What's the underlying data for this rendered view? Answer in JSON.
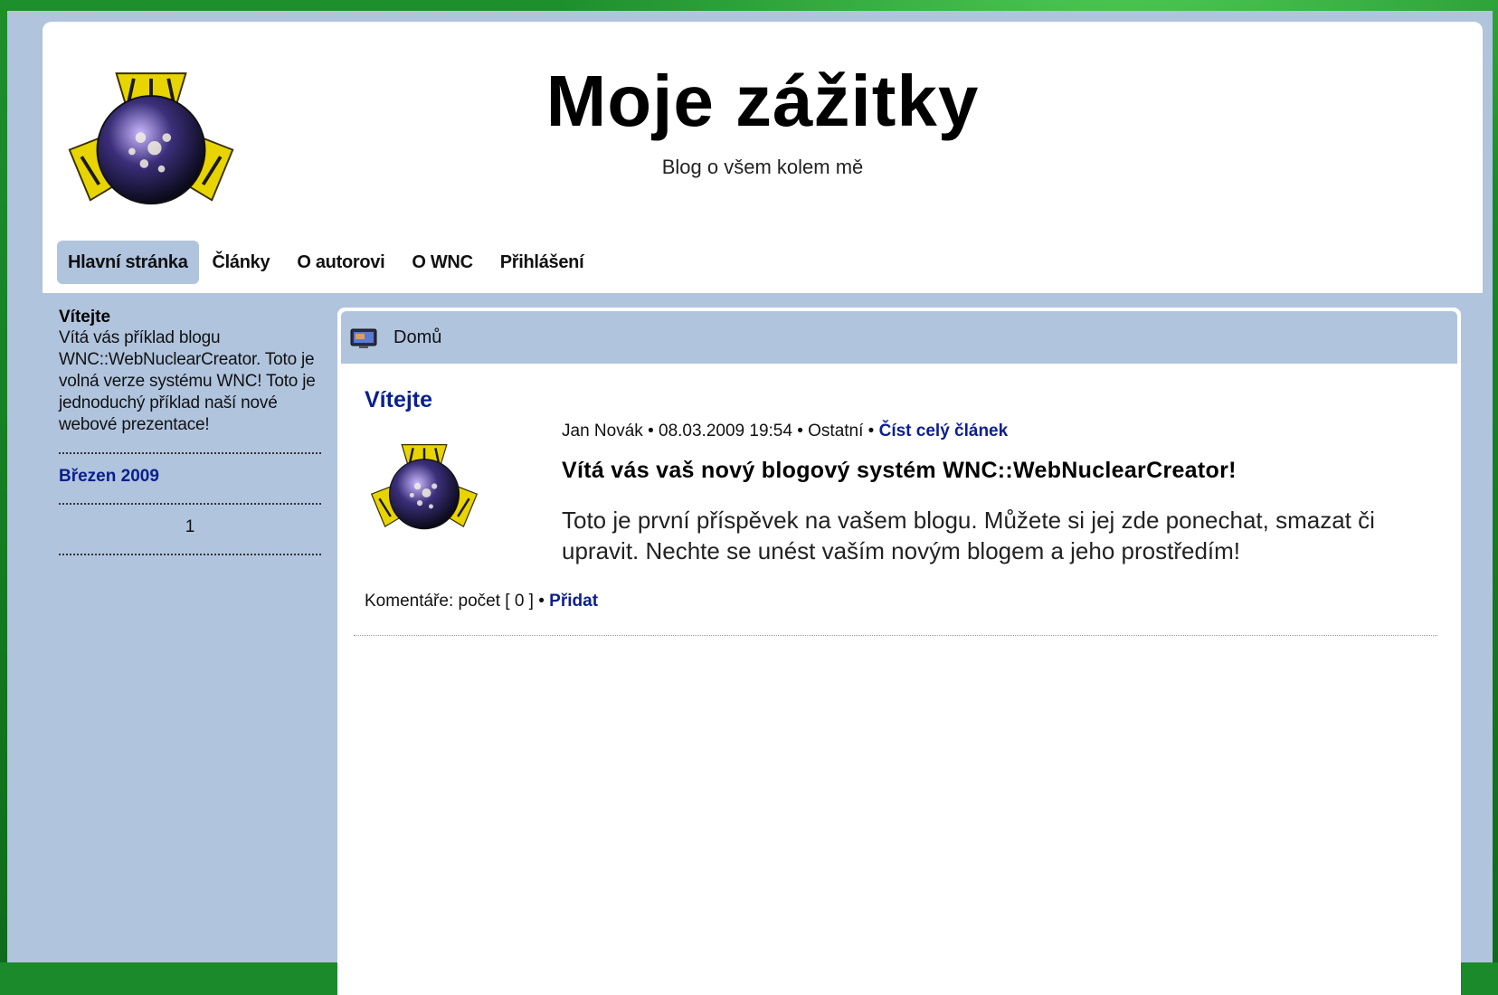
{
  "site": {
    "title": "Moje zážitky",
    "subtitle": "Blog o všem kolem mě",
    "logo_icon": "radiation-globe-icon"
  },
  "nav": {
    "items": [
      {
        "label": "Hlavní stránka",
        "active": true
      },
      {
        "label": "Články"
      },
      {
        "label": "O autorovi"
      },
      {
        "label": "O WNC"
      },
      {
        "label": "Přihlášení"
      }
    ]
  },
  "sidebar": {
    "welcome_title": "Vítejte",
    "welcome_text": "Vítá vás příklad blogu WNC::WebNuclearCreator. Toto je volná verze systému WNC! Toto je jednoduchý příklad naší nové webové prezentace!",
    "archive_month": "Březen 2009",
    "page_number": "1"
  },
  "breadcrumb": {
    "icon": "monitor-icon",
    "label": "Domů"
  },
  "post": {
    "title": "Vítejte",
    "author": "Jan Novák",
    "date": "08.03.2009 19:54",
    "category": "Ostatní",
    "read_more": "Číst celý článek",
    "headline": "Vítá vás vaš nový blogový systém WNC::WebNuclearCreator!",
    "body": "Toto je první příspěvek na vašem blogu. Můžete si jej zde ponechat, smazat či upravit. Nechte se unést vaším novým blogem a jeho prostředím!",
    "comments_label": "Komentáře: počet [ 0 ]",
    "add_label": "Přidat"
  },
  "colors": {
    "background_green": "#1a8a2a",
    "frame_blue": "#b0c4de",
    "link_blue": "#0a1f8f"
  }
}
